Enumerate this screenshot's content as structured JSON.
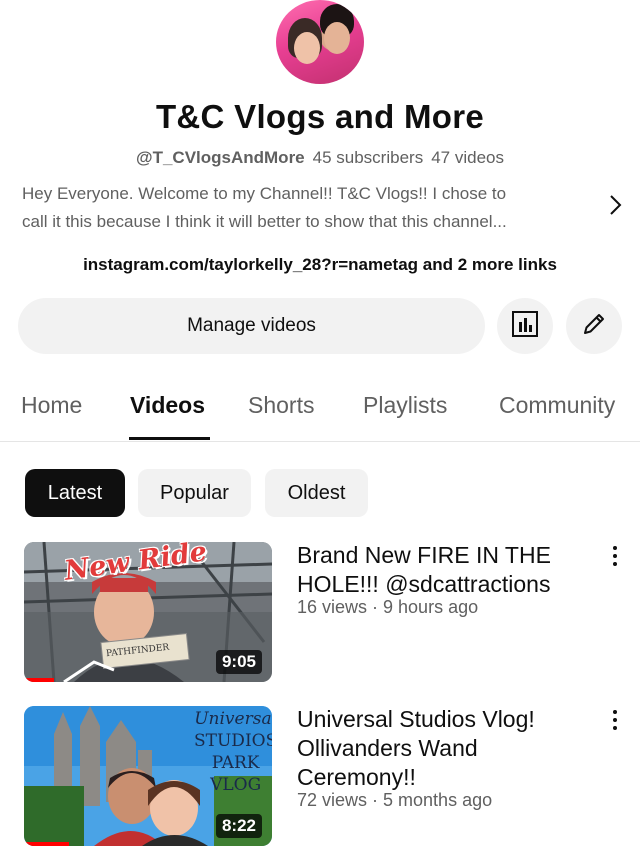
{
  "channel": {
    "name": "T&C Vlogs and More",
    "handle": "@T_CVlogsAndMore",
    "subscribers": "45 subscribers",
    "videos": "47 videos",
    "description_line1": "Hey Everyone. Welcome to my Channel!! T&C Vlogs!! I chose to",
    "description_line2": "call it this because I think it will better to show that this channel...",
    "links": "instagram.com/taylorkelly_28?r=nametag and 2 more links"
  },
  "actions": {
    "manage_label": "Manage videos",
    "analytics_icon": "analytics-icon",
    "edit_icon": "pencil-icon"
  },
  "tabs": [
    {
      "label": "Home"
    },
    {
      "label": "Videos"
    },
    {
      "label": "Shorts"
    },
    {
      "label": "Playlists"
    },
    {
      "label": "Community"
    }
  ],
  "filters": [
    {
      "label": "Latest"
    },
    {
      "label": "Popular"
    },
    {
      "label": "Oldest"
    }
  ],
  "videos": [
    {
      "title": "Brand New FIRE IN THE HOLE!!! @sdcattractions",
      "meta": "16 views · 9 hours ago",
      "duration": "9:05",
      "thumb_text": "New Ride",
      "sign_text": "PATHFINDER",
      "progress": 0.12
    },
    {
      "title": "Universal Studios Vlog! Ollivanders Wand Ceremony!!",
      "meta": "72 views · 5 months ago",
      "duration": "8:22",
      "thumb_text_1": "Universal",
      "thumb_text_2": "STUDIOS",
      "thumb_text_3": "PARK VLOG",
      "progress": 0.18
    }
  ],
  "colors": {
    "accent": "#ff0000",
    "text_primary": "#0f0f0f",
    "text_secondary": "#606060",
    "chip_bg": "#f2f2f2"
  }
}
